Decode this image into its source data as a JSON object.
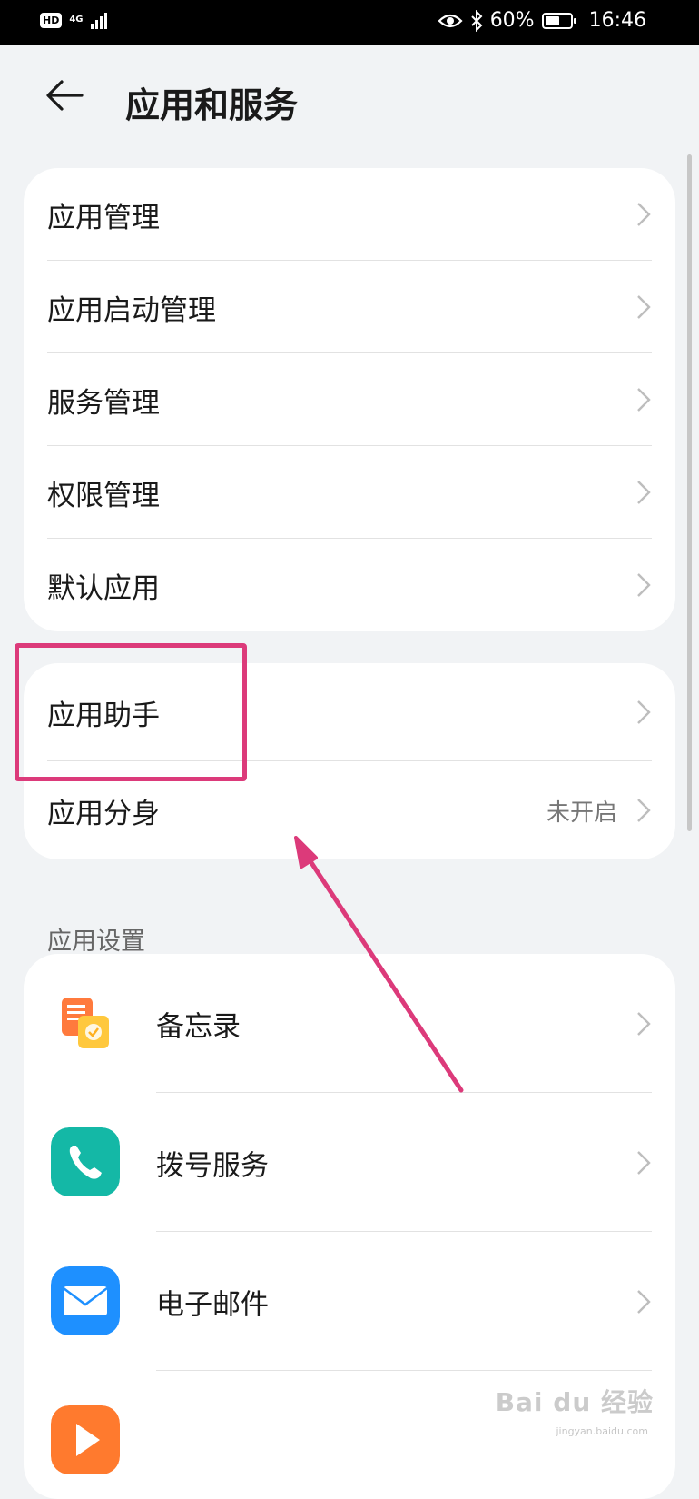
{
  "status_bar": {
    "hd": "HD",
    "network": "4G",
    "battery": "60%",
    "battery_level": 0.6,
    "time": "16:46"
  },
  "header": {
    "title": "应用和服务",
    "back_icon": "arrow-left-icon"
  },
  "group1": {
    "items": [
      {
        "label": "应用管理"
      },
      {
        "label": "应用启动管理"
      },
      {
        "label": "服务管理"
      },
      {
        "label": "权限管理"
      },
      {
        "label": "默认应用"
      }
    ]
  },
  "group2": {
    "items": [
      {
        "label": "应用助手"
      },
      {
        "label": "应用分身",
        "value": "未开启"
      }
    ]
  },
  "app_settings": {
    "title": "应用设置",
    "items": [
      {
        "label": "备忘录",
        "icon": "memo-app-icon"
      },
      {
        "label": "拨号服务",
        "icon": "phone-app-icon"
      },
      {
        "label": "电子邮件",
        "icon": "email-app-icon"
      },
      {
        "label": "",
        "icon": "video-app-icon"
      }
    ]
  },
  "annotation": {
    "highlight_color": "#dc3a7a"
  },
  "watermark": {
    "text": "Bai du 经验",
    "sub": "jingyan.baidu.com"
  },
  "colors": {
    "background": "#f1f3f5",
    "card": "#ffffff",
    "secondary_text": "#777777"
  }
}
